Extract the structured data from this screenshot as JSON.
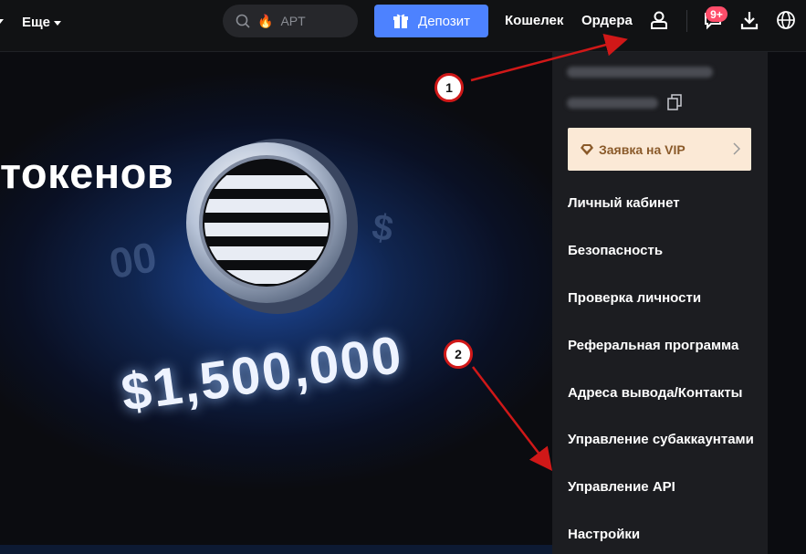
{
  "topbar": {
    "more_label": "Еще",
    "search_placeholder": "APT",
    "deposit_label": "Депозит",
    "wallet_label": "Кошелек",
    "orders_label": "Ордера",
    "notifications_badge": "9+"
  },
  "banner": {
    "headline": "токенов",
    "prize": "$1,500,000"
  },
  "dropdown": {
    "vip_label": "Заявка на VIP",
    "items": [
      {
        "label": "Личный кабинет"
      },
      {
        "label": "Безопасность"
      },
      {
        "label": "Проверка личности"
      },
      {
        "label": "Реферальная программа"
      },
      {
        "label": "Адреса вывода/Контакты"
      },
      {
        "label": "Управление субаккаунтами"
      },
      {
        "label": "Управление API"
      },
      {
        "label": "Настройки"
      }
    ]
  },
  "annotations": {
    "marker1": "1",
    "marker2": "2"
  },
  "colors": {
    "accent": "#4d82ff",
    "badge": "#ff4d6a",
    "vip_bg": "#fbe9d6",
    "annotation": "#d01818"
  }
}
